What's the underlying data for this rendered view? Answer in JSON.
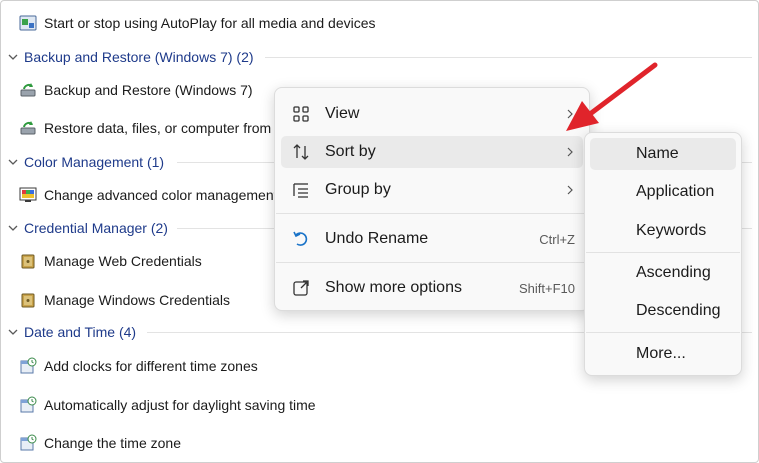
{
  "list": {
    "top_item": "Start or stop using AutoPlay for all media and devices",
    "groups": [
      {
        "header": "Backup and Restore (Windows 7) (2)",
        "items": [
          "Backup and Restore (Windows 7)",
          "Restore data, files, or computer from"
        ]
      },
      {
        "header": "Color Management (1)",
        "items": [
          "Change advanced color management"
        ]
      },
      {
        "header": "Credential Manager (2)",
        "items": [
          "Manage Web Credentials",
          "Manage Windows Credentials"
        ]
      },
      {
        "header": "Date and Time (4)",
        "items": [
          "Add clocks for different time zones",
          "Automatically adjust for daylight saving time",
          "Change the time zone"
        ]
      }
    ]
  },
  "context_menu": {
    "items": [
      {
        "label": "View",
        "icon": "grid-icon",
        "has_submenu": true
      },
      {
        "label": "Sort by",
        "icon": "sort-arrows-icon",
        "has_submenu": true
      },
      {
        "label": "Group by",
        "icon": "list-group-icon",
        "has_submenu": true
      },
      {
        "label": "Undo Rename",
        "icon": "undo-icon",
        "shortcut": "Ctrl+Z"
      },
      {
        "label": "Show more options",
        "icon": "open-external-icon",
        "shortcut": "Shift+F10"
      }
    ],
    "highlighted": "Sort by"
  },
  "sort_submenu": {
    "items": [
      "Name",
      "Application",
      "Keywords",
      "Ascending",
      "Descending",
      "More..."
    ],
    "highlighted": "Name"
  },
  "colors": {
    "group_header": "#1e3a8a",
    "annotation_arrow": "#e0242b",
    "menu_bg": "#f9f9f9",
    "menu_hover": "#eaeaea"
  }
}
